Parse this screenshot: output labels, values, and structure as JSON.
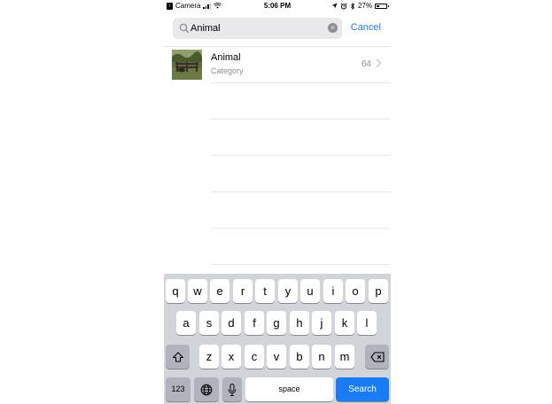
{
  "status_bar": {
    "back_app": "Camera",
    "time": "5:06 PM",
    "battery_pct": "27%",
    "battery_level": 0.27
  },
  "search": {
    "query": "Animal",
    "cancel_label": "Cancel"
  },
  "results": [
    {
      "title": "Animal",
      "subtitle": "Category",
      "count": "64"
    }
  ],
  "keyboard": {
    "row1": [
      "q",
      "w",
      "e",
      "r",
      "t",
      "y",
      "u",
      "i",
      "o",
      "p"
    ],
    "row2": [
      "a",
      "s",
      "d",
      "f",
      "g",
      "h",
      "j",
      "k",
      "l"
    ],
    "row3": [
      "z",
      "x",
      "c",
      "v",
      "b",
      "n",
      "m"
    ],
    "numbers_label": "123",
    "space_label": "space",
    "search_label": "Search"
  },
  "colors": {
    "accent": "#1a7cf5",
    "keyboard_bg": "#d1d4d9"
  },
  "icons": {
    "search": "search-icon",
    "clear": "clear-icon",
    "chevron": "chevron-right-icon",
    "shift": "shift-icon",
    "delete": "delete-icon",
    "globe": "globe-icon",
    "mic": "mic-icon"
  }
}
